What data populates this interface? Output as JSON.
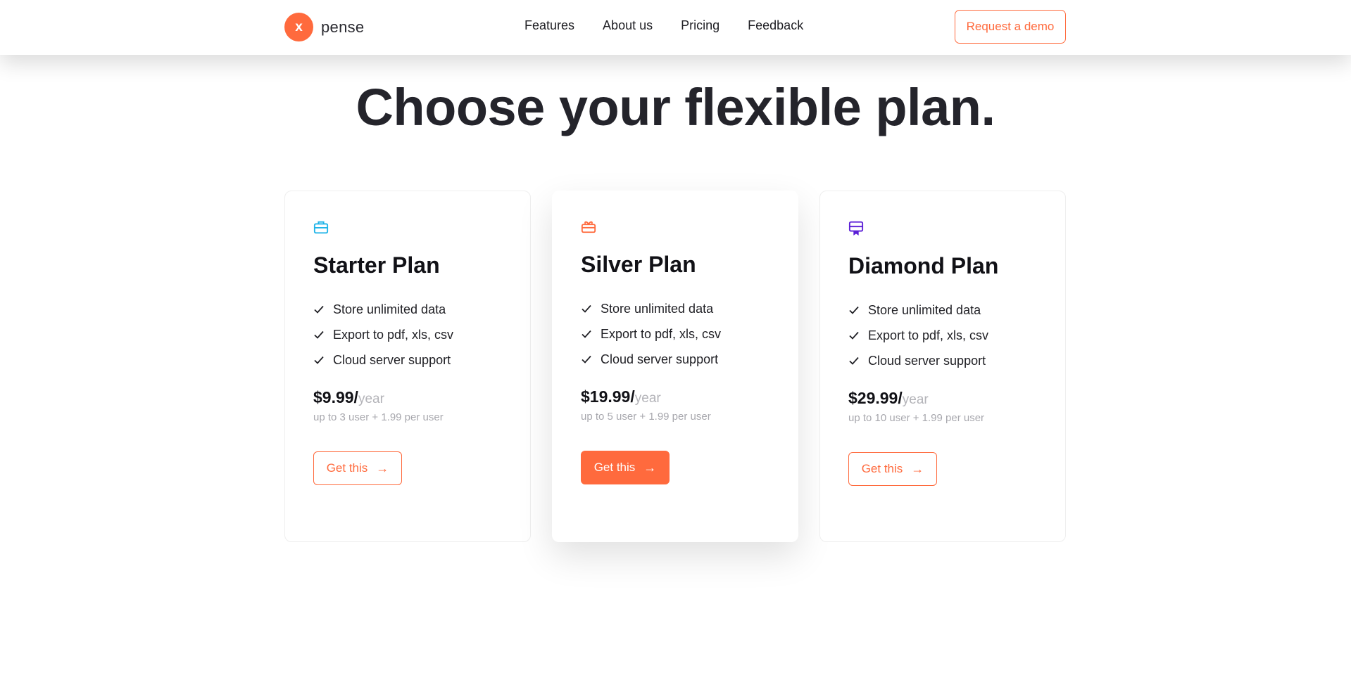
{
  "colors": {
    "accent": "#ff6a3d",
    "starter_icon": "#20b4e8",
    "silver_icon": "#ff6a3d",
    "diamond_icon": "#5b1fd6"
  },
  "header": {
    "logo_letter": "x",
    "brand_name": "pense",
    "nav": [
      "Features",
      "About us",
      "Pricing",
      "Feedback"
    ],
    "cta_label": "Request a demo"
  },
  "page": {
    "title": "Choose your flexible plan."
  },
  "plans": [
    {
      "icon": "briefcase-icon",
      "name": "Starter Plan",
      "features": [
        "Store unlimited data",
        "Export to pdf, xls, csv",
        "Cloud server support"
      ],
      "price": "$9.99/",
      "period": "year",
      "note": "up to 3 user + 1.99 per user",
      "button_label": "Get this",
      "button_arrow": "→"
    },
    {
      "icon": "gift-icon",
      "name": "Silver Plan",
      "features": [
        "Store unlimited data",
        "Export to pdf, xls, csv",
        "Cloud server support"
      ],
      "price": "$19.99/",
      "period": "year",
      "note": "up to 5 user + 1.99 per user",
      "button_label": "Get this",
      "button_arrow": "→"
    },
    {
      "icon": "certificate-icon",
      "name": "Diamond Plan",
      "features": [
        "Store unlimited data",
        "Export to pdf, xls, csv",
        "Cloud server support"
      ],
      "price": "$29.99/",
      "period": "year",
      "note": "up to 10 user + 1.99 per user",
      "button_label": "Get this",
      "button_arrow": "→"
    }
  ]
}
